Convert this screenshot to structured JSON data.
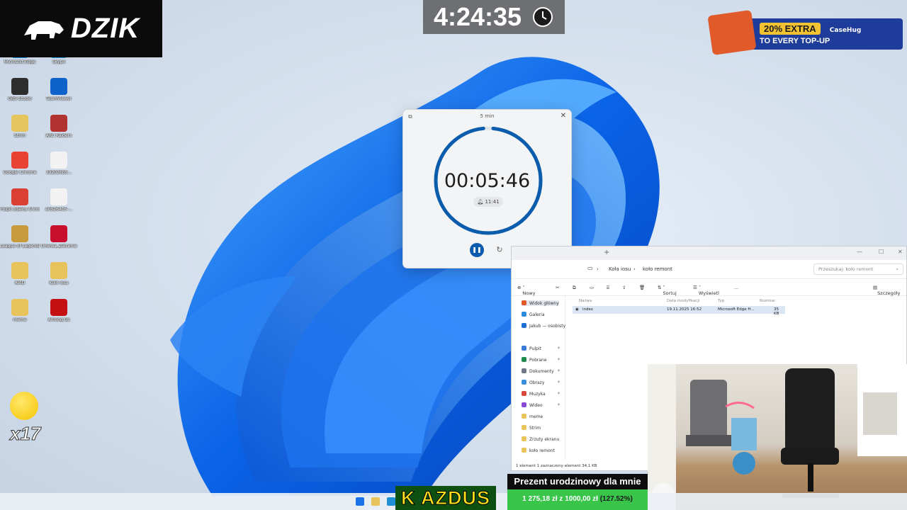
{
  "overlay": {
    "logo_text": "DZIK",
    "stream_clock": "4:24:35",
    "sponsor_offer": "20% EXTRA",
    "sponsor_brand": "CaseHug",
    "sponsor_line": "TO EVERY TOP-UP",
    "emote_multiplier": "x17",
    "chat_name": "K AZDUS",
    "goal_title": "Prezent urodzinowy dla mnie",
    "goal_amount": "1 275,18 zł z 1000,00 zł",
    "goal_percent": "(127.52%)",
    "goal_progress": 1.0
  },
  "desktop_icons": [
    {
      "label": "Microsoft Edge",
      "color": "#1f8fd6"
    },
    {
      "label": "Skype",
      "color": "#2a9bd8"
    },
    {
      "label": "OBS Studio",
      "color": "#2d2d2d"
    },
    {
      "label": "TeamViewer",
      "color": "#0e62c9"
    },
    {
      "label": "Strim",
      "color": "#e5c55d"
    },
    {
      "label": "ARC Raiders",
      "color": "#b0332f"
    },
    {
      "label": "Google Chrome",
      "color": "#e94235"
    },
    {
      "label": "192026b5...",
      "color": "#f2f2f2"
    },
    {
      "label": "Pulpit zdalny Chrome",
      "color": "#d93f32"
    },
    {
      "label": "e05264c6-...",
      "color": "#f2f2f2"
    },
    {
      "label": "League of Legends",
      "color": "#c79b3b"
    },
    {
      "label": "Umowa_Zlecenie",
      "color": "#c8102e"
    },
    {
      "label": "AVID",
      "color": "#e8c25a"
    },
    {
      "label": "Kolo iosu",
      "color": "#e8c25a"
    },
    {
      "label": "meme",
      "color": "#e8c25a"
    },
    {
      "label": "Among Us",
      "color": "#c51111"
    }
  ],
  "timer_window": {
    "title": "5 min",
    "time": "00:05:46",
    "alarm": "11:41",
    "progress": 0.97,
    "accent": "#0b5cad"
  },
  "explorer": {
    "breadcrumb": [
      "Koła iosu",
      "koło remont"
    ],
    "search_placeholder": "Przeszukaj: koło remont",
    "toolbar": {
      "new": "Nowy",
      "sort": "Sortuj",
      "view": "Wyświetl",
      "more": "...",
      "details": "Szczegóły"
    },
    "columns": {
      "name": "Nazwa",
      "modified": "Data modyfikacji",
      "type": "Typ",
      "size": "Rozmiar"
    },
    "nav_items": [
      {
        "label": "Widok główny",
        "color": "#e05a2a"
      },
      {
        "label": "Galeria",
        "color": "#2e8bd8"
      },
      {
        "label": "Jakub — osobisty",
        "color": "#1a6fd1"
      },
      {
        "label": "Pulpit",
        "color": "#3a7bd5"
      },
      {
        "label": "Pobrane",
        "color": "#1e8c4b"
      },
      {
        "label": "Dokumenty",
        "color": "#6f7a86"
      },
      {
        "label": "Obrazy",
        "color": "#3a8fd9"
      },
      {
        "label": "Muzyka",
        "color": "#d9483a"
      },
      {
        "label": "Wideo",
        "color": "#8b4bd1"
      },
      {
        "label": "meme",
        "color": "#e8c25a"
      },
      {
        "label": "Strim",
        "color": "#e8c25a"
      },
      {
        "label": "Zrzuty ekranu",
        "color": "#e8c25a"
      },
      {
        "label": "koło remont",
        "color": "#e8c25a"
      }
    ],
    "file": {
      "name": "index",
      "modified": "19.11.2025 16:52",
      "type": "Microsoft Edge H...",
      "size": "35 KB"
    },
    "status": "1 element   1 zaznaczony element  34,1 KB"
  }
}
